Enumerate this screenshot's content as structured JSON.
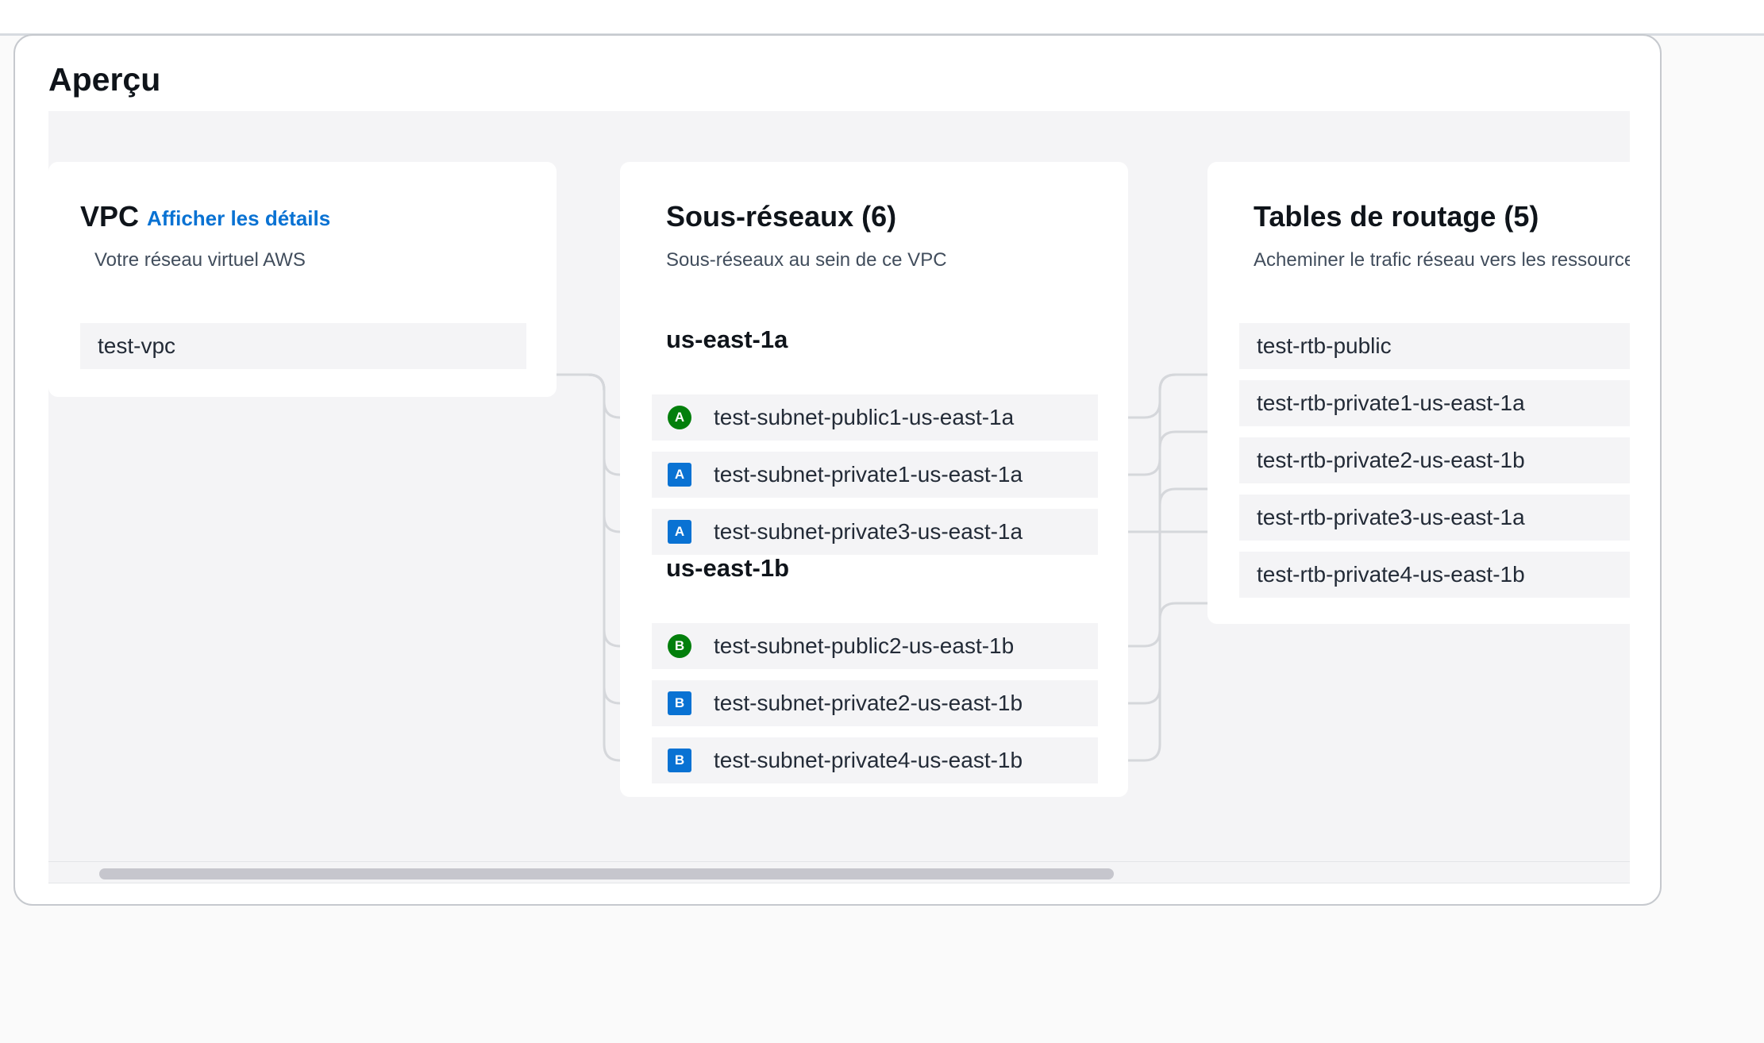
{
  "page": {
    "title": "Aperçu"
  },
  "vpc_card": {
    "title": "VPC",
    "details_link": "Afficher les détails",
    "description": "Votre réseau virtuel AWS",
    "item": "test-vpc"
  },
  "subnets_card": {
    "title": "Sous-réseaux (6)",
    "description": "Sous-réseaux au sein de ce VPC",
    "zones": [
      {
        "name": "us-east-1a",
        "subnets": [
          {
            "name": "test-subnet-public1-us-east-1a",
            "badge": "A",
            "kind": "public"
          },
          {
            "name": "test-subnet-private1-us-east-1a",
            "badge": "A",
            "kind": "private"
          },
          {
            "name": "test-subnet-private3-us-east-1a",
            "badge": "A",
            "kind": "private"
          }
        ]
      },
      {
        "name": "us-east-1b",
        "subnets": [
          {
            "name": "test-subnet-public2-us-east-1b",
            "badge": "B",
            "kind": "public"
          },
          {
            "name": "test-subnet-private2-us-east-1b",
            "badge": "B",
            "kind": "private"
          },
          {
            "name": "test-subnet-private4-us-east-1b",
            "badge": "B",
            "kind": "private"
          }
        ]
      }
    ]
  },
  "route_tables_card": {
    "title": "Tables de routage (5)",
    "description": "Acheminer le trafic réseau vers les ressources",
    "items": [
      "test-rtb-public",
      "test-rtb-private1-us-east-1a",
      "test-rtb-private2-us-east-1b",
      "test-rtb-private3-us-east-1a",
      "test-rtb-private4-us-east-1b"
    ]
  },
  "colors": {
    "public_badge": "#037f0c",
    "private_badge": "#0972d3",
    "link": "#0972d3",
    "connector": "#d5d7db"
  },
  "icons": {
    "public": "circle-badge-icon",
    "private": "square-badge-icon"
  }
}
